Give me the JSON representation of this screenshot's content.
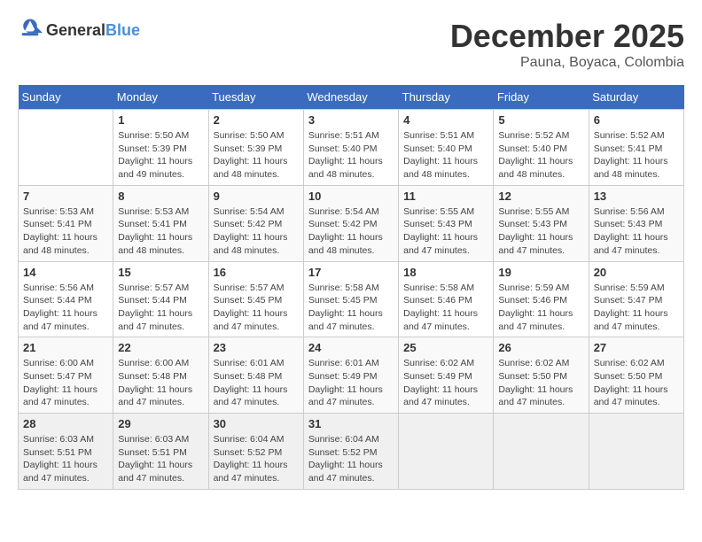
{
  "header": {
    "logo_general": "General",
    "logo_blue": "Blue",
    "month_year": "December 2025",
    "location": "Pauna, Boyaca, Colombia"
  },
  "weekdays": [
    "Sunday",
    "Monday",
    "Tuesday",
    "Wednesday",
    "Thursday",
    "Friday",
    "Saturday"
  ],
  "weeks": [
    [
      {
        "day": "",
        "sunrise": "",
        "sunset": "",
        "daylight": ""
      },
      {
        "day": "1",
        "sunrise": "Sunrise: 5:50 AM",
        "sunset": "Sunset: 5:39 PM",
        "daylight": "Daylight: 11 hours and 49 minutes."
      },
      {
        "day": "2",
        "sunrise": "Sunrise: 5:50 AM",
        "sunset": "Sunset: 5:39 PM",
        "daylight": "Daylight: 11 hours and 48 minutes."
      },
      {
        "day": "3",
        "sunrise": "Sunrise: 5:51 AM",
        "sunset": "Sunset: 5:40 PM",
        "daylight": "Daylight: 11 hours and 48 minutes."
      },
      {
        "day": "4",
        "sunrise": "Sunrise: 5:51 AM",
        "sunset": "Sunset: 5:40 PM",
        "daylight": "Daylight: 11 hours and 48 minutes."
      },
      {
        "day": "5",
        "sunrise": "Sunrise: 5:52 AM",
        "sunset": "Sunset: 5:40 PM",
        "daylight": "Daylight: 11 hours and 48 minutes."
      },
      {
        "day": "6",
        "sunrise": "Sunrise: 5:52 AM",
        "sunset": "Sunset: 5:41 PM",
        "daylight": "Daylight: 11 hours and 48 minutes."
      }
    ],
    [
      {
        "day": "7",
        "sunrise": "Sunrise: 5:53 AM",
        "sunset": "Sunset: 5:41 PM",
        "daylight": "Daylight: 11 hours and 48 minutes."
      },
      {
        "day": "8",
        "sunrise": "Sunrise: 5:53 AM",
        "sunset": "Sunset: 5:41 PM",
        "daylight": "Daylight: 11 hours and 48 minutes."
      },
      {
        "day": "9",
        "sunrise": "Sunrise: 5:54 AM",
        "sunset": "Sunset: 5:42 PM",
        "daylight": "Daylight: 11 hours and 48 minutes."
      },
      {
        "day": "10",
        "sunrise": "Sunrise: 5:54 AM",
        "sunset": "Sunset: 5:42 PM",
        "daylight": "Daylight: 11 hours and 48 minutes."
      },
      {
        "day": "11",
        "sunrise": "Sunrise: 5:55 AM",
        "sunset": "Sunset: 5:43 PM",
        "daylight": "Daylight: 11 hours and 47 minutes."
      },
      {
        "day": "12",
        "sunrise": "Sunrise: 5:55 AM",
        "sunset": "Sunset: 5:43 PM",
        "daylight": "Daylight: 11 hours and 47 minutes."
      },
      {
        "day": "13",
        "sunrise": "Sunrise: 5:56 AM",
        "sunset": "Sunset: 5:43 PM",
        "daylight": "Daylight: 11 hours and 47 minutes."
      }
    ],
    [
      {
        "day": "14",
        "sunrise": "Sunrise: 5:56 AM",
        "sunset": "Sunset: 5:44 PM",
        "daylight": "Daylight: 11 hours and 47 minutes."
      },
      {
        "day": "15",
        "sunrise": "Sunrise: 5:57 AM",
        "sunset": "Sunset: 5:44 PM",
        "daylight": "Daylight: 11 hours and 47 minutes."
      },
      {
        "day": "16",
        "sunrise": "Sunrise: 5:57 AM",
        "sunset": "Sunset: 5:45 PM",
        "daylight": "Daylight: 11 hours and 47 minutes."
      },
      {
        "day": "17",
        "sunrise": "Sunrise: 5:58 AM",
        "sunset": "Sunset: 5:45 PM",
        "daylight": "Daylight: 11 hours and 47 minutes."
      },
      {
        "day": "18",
        "sunrise": "Sunrise: 5:58 AM",
        "sunset": "Sunset: 5:46 PM",
        "daylight": "Daylight: 11 hours and 47 minutes."
      },
      {
        "day": "19",
        "sunrise": "Sunrise: 5:59 AM",
        "sunset": "Sunset: 5:46 PM",
        "daylight": "Daylight: 11 hours and 47 minutes."
      },
      {
        "day": "20",
        "sunrise": "Sunrise: 5:59 AM",
        "sunset": "Sunset: 5:47 PM",
        "daylight": "Daylight: 11 hours and 47 minutes."
      }
    ],
    [
      {
        "day": "21",
        "sunrise": "Sunrise: 6:00 AM",
        "sunset": "Sunset: 5:47 PM",
        "daylight": "Daylight: 11 hours and 47 minutes."
      },
      {
        "day": "22",
        "sunrise": "Sunrise: 6:00 AM",
        "sunset": "Sunset: 5:48 PM",
        "daylight": "Daylight: 11 hours and 47 minutes."
      },
      {
        "day": "23",
        "sunrise": "Sunrise: 6:01 AM",
        "sunset": "Sunset: 5:48 PM",
        "daylight": "Daylight: 11 hours and 47 minutes."
      },
      {
        "day": "24",
        "sunrise": "Sunrise: 6:01 AM",
        "sunset": "Sunset: 5:49 PM",
        "daylight": "Daylight: 11 hours and 47 minutes."
      },
      {
        "day": "25",
        "sunrise": "Sunrise: 6:02 AM",
        "sunset": "Sunset: 5:49 PM",
        "daylight": "Daylight: 11 hours and 47 minutes."
      },
      {
        "day": "26",
        "sunrise": "Sunrise: 6:02 AM",
        "sunset": "Sunset: 5:50 PM",
        "daylight": "Daylight: 11 hours and 47 minutes."
      },
      {
        "day": "27",
        "sunrise": "Sunrise: 6:02 AM",
        "sunset": "Sunset: 5:50 PM",
        "daylight": "Daylight: 11 hours and 47 minutes."
      }
    ],
    [
      {
        "day": "28",
        "sunrise": "Sunrise: 6:03 AM",
        "sunset": "Sunset: 5:51 PM",
        "daylight": "Daylight: 11 hours and 47 minutes."
      },
      {
        "day": "29",
        "sunrise": "Sunrise: 6:03 AM",
        "sunset": "Sunset: 5:51 PM",
        "daylight": "Daylight: 11 hours and 47 minutes."
      },
      {
        "day": "30",
        "sunrise": "Sunrise: 6:04 AM",
        "sunset": "Sunset: 5:52 PM",
        "daylight": "Daylight: 11 hours and 47 minutes."
      },
      {
        "day": "31",
        "sunrise": "Sunrise: 6:04 AM",
        "sunset": "Sunset: 5:52 PM",
        "daylight": "Daylight: 11 hours and 47 minutes."
      },
      {
        "day": "",
        "sunrise": "",
        "sunset": "",
        "daylight": ""
      },
      {
        "day": "",
        "sunrise": "",
        "sunset": "",
        "daylight": ""
      },
      {
        "day": "",
        "sunrise": "",
        "sunset": "",
        "daylight": ""
      }
    ]
  ]
}
